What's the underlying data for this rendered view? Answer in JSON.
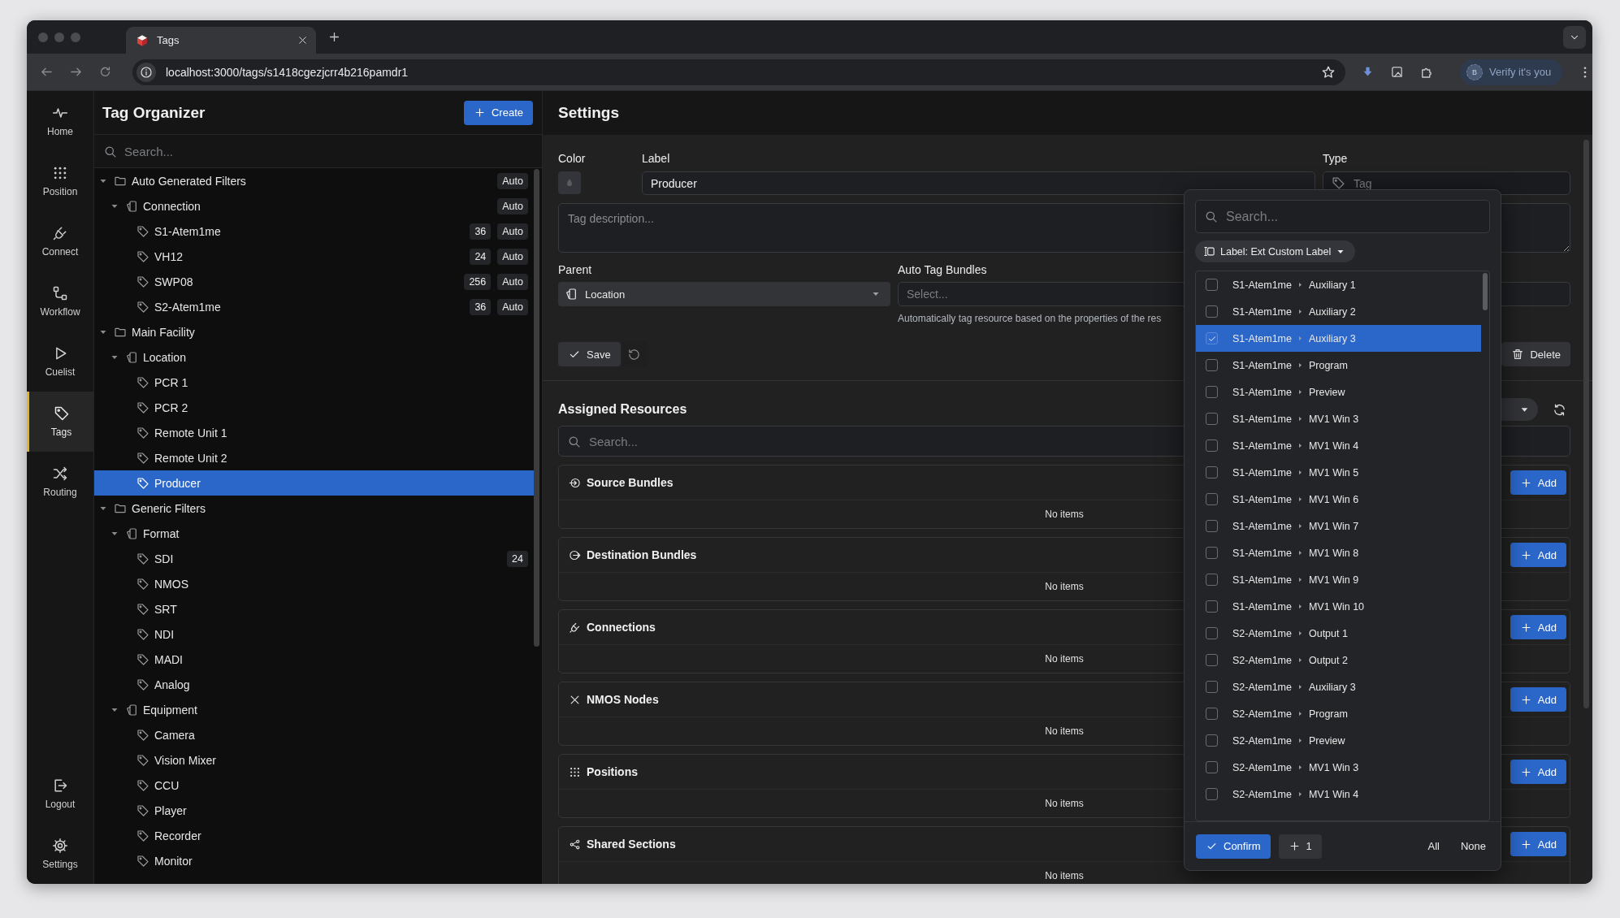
{
  "browser": {
    "tab_title": "Tags",
    "url": "localhost:3000/tags/s1418cgezjcrr4b216pamdr1",
    "profile_initial": "B",
    "profile_button": "Verify it's you"
  },
  "nav": {
    "items": [
      {
        "label": "Home",
        "selected": false
      },
      {
        "label": "Position",
        "selected": false
      },
      {
        "label": "Connect",
        "selected": false
      },
      {
        "label": "Workflow",
        "selected": false
      },
      {
        "label": "Cuelist",
        "selected": false
      },
      {
        "label": "Tags",
        "selected": true
      },
      {
        "label": "Routing",
        "selected": false
      }
    ],
    "footer_items": [
      {
        "label": "Logout"
      },
      {
        "label": "Settings"
      }
    ]
  },
  "tree_panel": {
    "title": "Tag Organizer",
    "create_button": "Create",
    "search": {
      "placeholder": "Search..."
    },
    "tree": [
      {
        "kind": "folder",
        "label": "Auto Generated Filters",
        "expanded": true,
        "badges": [
          "Auto"
        ],
        "selected": false,
        "children": [
          {
            "kind": "group",
            "label": "Connection",
            "expanded": true,
            "badges": [
              "Auto"
            ],
            "selected": false,
            "children": [
              {
                "kind": "tag",
                "label": "S1-Atem1me",
                "badges": [
                  "36",
                  "Auto"
                ],
                "selected": false
              },
              {
                "kind": "tag",
                "label": "VH12",
                "badges": [
                  "24",
                  "Auto"
                ],
                "selected": false
              },
              {
                "kind": "tag",
                "label": "SWP08",
                "badges": [
                  "256",
                  "Auto"
                ],
                "selected": false
              },
              {
                "kind": "tag",
                "label": "S2-Atem1me",
                "badges": [
                  "36",
                  "Auto"
                ],
                "selected": false
              }
            ]
          }
        ]
      },
      {
        "kind": "folder",
        "label": "Main Facility",
        "expanded": true,
        "selected": false,
        "children": [
          {
            "kind": "group",
            "label": "Location",
            "expanded": true,
            "selected": false,
            "children": [
              {
                "kind": "tag",
                "label": "PCR 1",
                "selected": false
              },
              {
                "kind": "tag",
                "label": "PCR 2",
                "selected": false
              },
              {
                "kind": "tag",
                "label": "Remote Unit 1",
                "selected": false
              },
              {
                "kind": "tag",
                "label": "Remote Unit 2",
                "selected": false
              },
              {
                "kind": "tag",
                "label": "Producer",
                "selected": true
              }
            ]
          }
        ]
      },
      {
        "kind": "folder",
        "label": "Generic Filters",
        "expanded": true,
        "selected": false,
        "children": [
          {
            "kind": "group",
            "label": "Format",
            "expanded": true,
            "selected": false,
            "children": [
              {
                "kind": "tag",
                "label": "SDI",
                "badges": [
                  "24"
                ],
                "selected": false
              },
              {
                "kind": "tag",
                "label": "NMOS",
                "selected": false
              },
              {
                "kind": "tag",
                "label": "SRT",
                "selected": false
              },
              {
                "kind": "tag",
                "label": "NDI",
                "selected": false
              },
              {
                "kind": "tag",
                "label": "MADI",
                "selected": false
              },
              {
                "kind": "tag",
                "label": "Analog",
                "selected": false
              }
            ]
          },
          {
            "kind": "group",
            "label": "Equipment",
            "expanded": true,
            "selected": false,
            "children": [
              {
                "kind": "tag",
                "label": "Camera",
                "selected": false
              },
              {
                "kind": "tag",
                "label": "Vision Mixer",
                "selected": false
              },
              {
                "kind": "tag",
                "label": "CCU",
                "selected": false
              },
              {
                "kind": "tag",
                "label": "Player",
                "selected": false
              },
              {
                "kind": "tag",
                "label": "Recorder",
                "selected": false
              },
              {
                "kind": "tag",
                "label": "Monitor",
                "selected": false
              }
            ]
          }
        ]
      }
    ]
  },
  "settings": {
    "title": "Settings",
    "color_label": "Color",
    "label_label": "Label",
    "label_value": "Producer",
    "type_label": "Type",
    "type": {
      "value": "Tag",
      "disabled": true
    },
    "description_placeholder": "Tag description...",
    "parent_label": "Parent",
    "parent_value": "Location",
    "bundles_label": "Auto Tag Bundles",
    "bundles_placeholder": "Select...",
    "bundles_help": "Automatically tag resource based on the properties of the res",
    "save_button": "Save",
    "delete_button": "Delete"
  },
  "assigned": {
    "title": "Assigned Resources",
    "search": {
      "placeholder": "Search..."
    },
    "sections": [
      {
        "title": "Source Bundles",
        "empty_text": "No items",
        "add_button": "Add"
      },
      {
        "title": "Destination Bundles",
        "empty_text": "No items",
        "add_button": "Add"
      },
      {
        "title": "Connections",
        "empty_text": "No items",
        "add_button": "Add"
      },
      {
        "title": "NMOS Nodes",
        "empty_text": "No items",
        "add_button": "Add"
      },
      {
        "title": "Positions",
        "empty_text": "No items",
        "add_button": "Add"
      },
      {
        "title": "Shared Sections",
        "empty_text": "No items",
        "add_button": "Add"
      }
    ]
  },
  "picker": {
    "search": {
      "placeholder": "Search..."
    },
    "filter_chip": "Label: Ext Custom Label",
    "items": [
      {
        "source": "S1-Atem1me",
        "name": "Auxiliary 1",
        "checked": false,
        "selected": false
      },
      {
        "source": "S1-Atem1me",
        "name": "Auxiliary 2",
        "checked": false,
        "selected": false
      },
      {
        "source": "S1-Atem1me",
        "name": "Auxiliary 3",
        "checked": true,
        "selected": true
      },
      {
        "source": "S1-Atem1me",
        "name": "Program",
        "checked": false,
        "selected": false
      },
      {
        "source": "S1-Atem1me",
        "name": "Preview",
        "checked": false,
        "selected": false
      },
      {
        "source": "S1-Atem1me",
        "name": "MV1 Win 3",
        "checked": false,
        "selected": false
      },
      {
        "source": "S1-Atem1me",
        "name": "MV1 Win 4",
        "checked": false,
        "selected": false
      },
      {
        "source": "S1-Atem1me",
        "name": "MV1 Win 5",
        "checked": false,
        "selected": false
      },
      {
        "source": "S1-Atem1me",
        "name": "MV1 Win 6",
        "checked": false,
        "selected": false
      },
      {
        "source": "S1-Atem1me",
        "name": "MV1 Win 7",
        "checked": false,
        "selected": false
      },
      {
        "source": "S1-Atem1me",
        "name": "MV1 Win 8",
        "checked": false,
        "selected": false
      },
      {
        "source": "S1-Atem1me",
        "name": "MV1 Win 9",
        "checked": false,
        "selected": false
      },
      {
        "source": "S1-Atem1me",
        "name": "MV1 Win 10",
        "checked": false,
        "selected": false
      },
      {
        "source": "S2-Atem1me",
        "name": "Output 1",
        "checked": false,
        "selected": false
      },
      {
        "source": "S2-Atem1me",
        "name": "Output 2",
        "checked": false,
        "selected": false
      },
      {
        "source": "S2-Atem1me",
        "name": "Auxiliary 3",
        "checked": false,
        "selected": false
      },
      {
        "source": "S2-Atem1me",
        "name": "Program",
        "checked": false,
        "selected": false
      },
      {
        "source": "S2-Atem1me",
        "name": "Preview",
        "checked": false,
        "selected": false
      },
      {
        "source": "S2-Atem1me",
        "name": "MV1 Win 3",
        "checked": false,
        "selected": false
      },
      {
        "source": "S2-Atem1me",
        "name": "MV1 Win 4",
        "checked": false,
        "selected": false
      }
    ],
    "confirm_button": "Confirm",
    "count_button": "1",
    "all_button": "All",
    "none_button": "None"
  }
}
